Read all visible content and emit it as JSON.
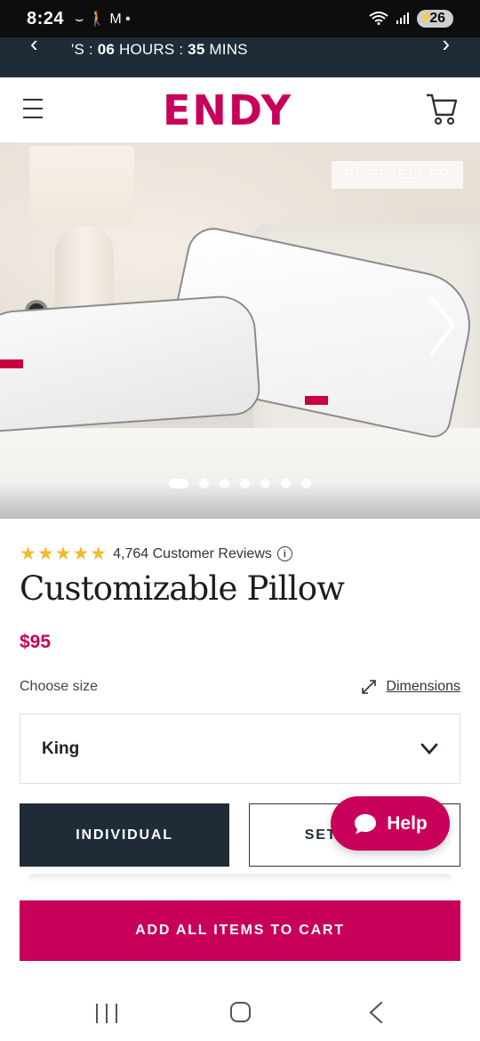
{
  "status_bar": {
    "time": "8:24",
    "left_icons": "⌣ 🚶 M •",
    "battery": "26"
  },
  "promo": {
    "text_prefix": "'S : ",
    "hours_value": "06",
    "hours_label": " HOURS : ",
    "mins_value": "35",
    "mins_label": " MINS"
  },
  "header": {
    "logo": "ENDY"
  },
  "hero": {
    "badge": "BESTSELLER",
    "pillow_tag": "ENDY",
    "slide_count": 7,
    "active_slide": 1
  },
  "product": {
    "stars": "★★★★★",
    "reviews": "4,764 Customer Reviews",
    "info_glyph": "i",
    "title": "Customizable Pillow",
    "price": "$95",
    "choose_size_label": "Choose size",
    "dimensions_label": "Dimensions",
    "selected_size": "King"
  },
  "buttons": {
    "individual": "INDIVIDUAL",
    "set": "SET",
    "help": "Help",
    "add_all_to_cart": "ADD ALL ITEMS TO CART"
  },
  "colors": {
    "brand": "#c8005a",
    "navy": "#1f2c37",
    "star": "#f5b82e"
  },
  "icons": {
    "menu": "hamburger-menu-icon",
    "cart": "cart-icon",
    "info": "info-icon",
    "expand": "expand-icon",
    "chevron": "chevron-down-icon",
    "chat": "chat-bubble-icon",
    "next": "chevron-right-icon"
  }
}
